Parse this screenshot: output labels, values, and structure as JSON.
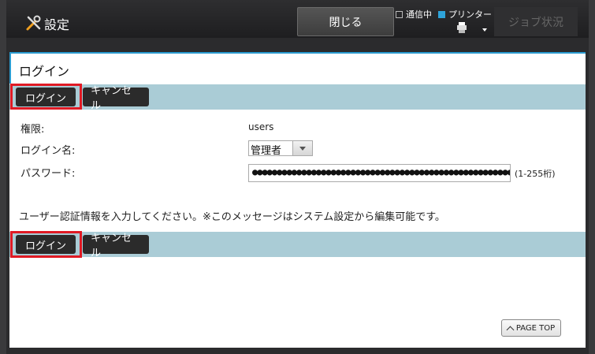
{
  "header": {
    "title": "設定",
    "close_label": "閉じる",
    "status_comm": "通信中",
    "status_printer": "プリンター",
    "job_status": "ジョブ状況"
  },
  "page": {
    "title": "ログイン"
  },
  "actions": {
    "login_label": "ログイン",
    "cancel_label": "キャンセル"
  },
  "form": {
    "authority_label": "権限:",
    "authority_value": "users",
    "login_name_label": "ログイン名:",
    "login_name_value": "管理者",
    "password_label": "パスワード:",
    "password_value": "●●●●●●●●●●●●●●●●●●●●●●●●●●●●●●●●●●●●●●●●●●●●●●●●●●●●●●●●●●●●",
    "password_hint": "(1-255桁)"
  },
  "message": "ユーザー認証情報を入力してください。※このメッセージはシステム設定から編集可能です。",
  "footer": {
    "page_top_label": "PAGE TOP"
  },
  "colors": {
    "accent": "#2a9bd0",
    "action_bar": "#aaccd6",
    "highlight": "#e01a24"
  }
}
